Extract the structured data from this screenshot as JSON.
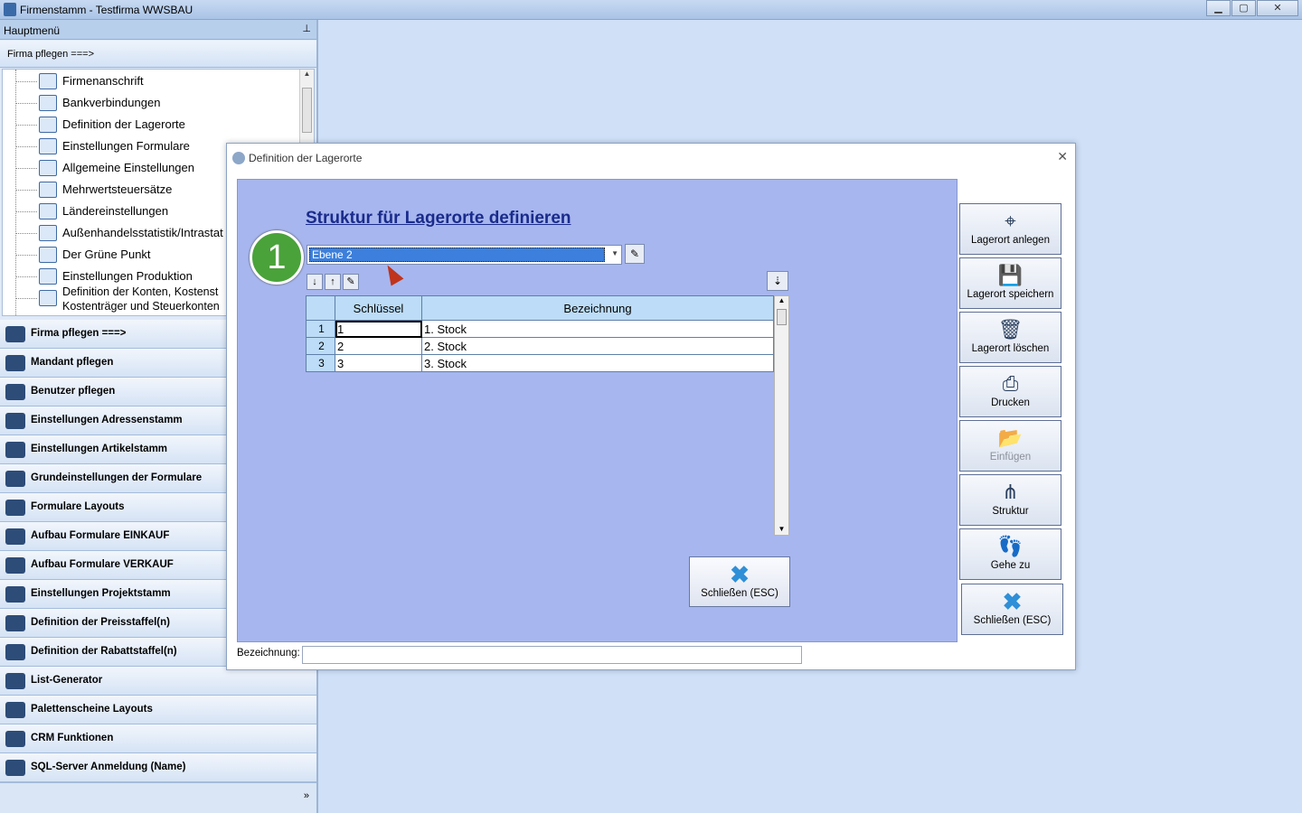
{
  "window": {
    "title": "Firmenstamm - Testfirma WWSBAU",
    "min_label": "▁",
    "max_label": "▢",
    "close_label": "✕"
  },
  "leftpanel": {
    "menu_title": "Hauptmenü",
    "pin": "⊥",
    "section_title": "Firma pflegen   ===>",
    "tree": [
      {
        "label": "Firmenanschrift",
        "icon": "address-card-icon"
      },
      {
        "label": "Bankverbindungen",
        "icon": "bank-icon"
      },
      {
        "label": "Definition der Lagerorte",
        "icon": "map-pin-icon"
      },
      {
        "label": "Einstellungen Formulare",
        "icon": "form-settings-icon"
      },
      {
        "label": "Allgemeine Einstellungen",
        "icon": "gears-icon"
      },
      {
        "label": "Mehrwertsteuersätze",
        "icon": "percent-icon"
      },
      {
        "label": "Ländereinstellungen",
        "icon": "globe-icon"
      },
      {
        "label": "Außenhandelsstatistik/Intrastat",
        "icon": "bar-chart-icon"
      },
      {
        "label": "Der Grüne Punkt",
        "icon": "recycle-icon"
      },
      {
        "label": "Einstellungen Produktion",
        "icon": "tools-icon"
      },
      {
        "label": "Definition der Konten, Kostenst",
        "icon": "accounts-icon"
      },
      {
        "label": "Kostenträger und Steuerkonten",
        "icon": ""
      }
    ],
    "nav": [
      {
        "label": "Firma pflegen   ===>",
        "icon": "factory-icon"
      },
      {
        "label": "Mandant pflegen",
        "icon": "mandant-icon"
      },
      {
        "label": "Benutzer pflegen",
        "icon": "users-icon"
      },
      {
        "label": "Einstellungen Adressenstamm",
        "icon": "address-icon"
      },
      {
        "label": "Einstellungen Artikelstamm",
        "icon": "article-icon"
      },
      {
        "label": "Grundeinstellungen der Formulare",
        "icon": "form-gear-icon"
      },
      {
        "label": "Formulare Layouts",
        "icon": "layout-icon"
      },
      {
        "label": "Aufbau Formulare EINKAUF",
        "icon": "download-tray-icon"
      },
      {
        "label": "Aufbau Formulare VERKAUF",
        "icon": "upload-tray-icon"
      },
      {
        "label": "Einstellungen Projektstamm",
        "icon": "project-icon"
      },
      {
        "label": "Definition der Preisstaffel(n)",
        "icon": "price-icon"
      },
      {
        "label": "Definition der Rabattstaffel(n)",
        "icon": "discount-icon"
      },
      {
        "label": "List-Generator",
        "icon": "list-icon"
      },
      {
        "label": "Palettenscheine Layouts",
        "icon": "pallet-icon"
      },
      {
        "label": "CRM Funktionen",
        "icon": "crm-icon"
      },
      {
        "label": "SQL-Server Anmeldung (Name)",
        "icon": "server-icon"
      }
    ],
    "more": "»"
  },
  "dialog": {
    "title": "Definition der Lagerorte",
    "close": "✕",
    "headline": "Struktur für Lagerorte definieren",
    "step": "1",
    "level_value": "Ebene 2",
    "grid": {
      "columns": [
        "",
        "Schlüssel",
        "Bezeichnung"
      ],
      "rows": [
        {
          "num": "1",
          "key": "1",
          "name": "1. Stock"
        },
        {
          "num": "2",
          "key": "2",
          "name": "2. Stock"
        },
        {
          "num": "3",
          "key": "3",
          "name": "3. Stock"
        }
      ]
    },
    "close_inner_label": "Schließen (ESC)",
    "bez_label": "Bezeichnung:",
    "bez_value": "",
    "side_buttons": [
      {
        "label": "Lagerort anlegen",
        "icon": "map-pin-icon",
        "glyph": "⌖",
        "disabled": false
      },
      {
        "label": "Lagerort speichern",
        "icon": "save-icon",
        "glyph": "💾",
        "disabled": false
      },
      {
        "label": "Lagerort löschen",
        "icon": "trash-icon",
        "glyph": "🗑",
        "disabled": false
      },
      {
        "label": "Drucken",
        "icon": "printer-icon",
        "glyph": "⎙",
        "disabled": false
      },
      {
        "label": "Einfügen",
        "icon": "paste-folder-icon",
        "glyph": "📂",
        "disabled": true
      },
      {
        "label": "Struktur",
        "icon": "tree-structure-icon",
        "glyph": "⋔",
        "disabled": false
      },
      {
        "label": "Gehe zu",
        "icon": "footprints-icon",
        "glyph": "👣",
        "disabled": false
      },
      {
        "label": "Schließen (ESC)",
        "icon": "close-x-icon",
        "glyph": "✖",
        "disabled": false
      }
    ]
  }
}
